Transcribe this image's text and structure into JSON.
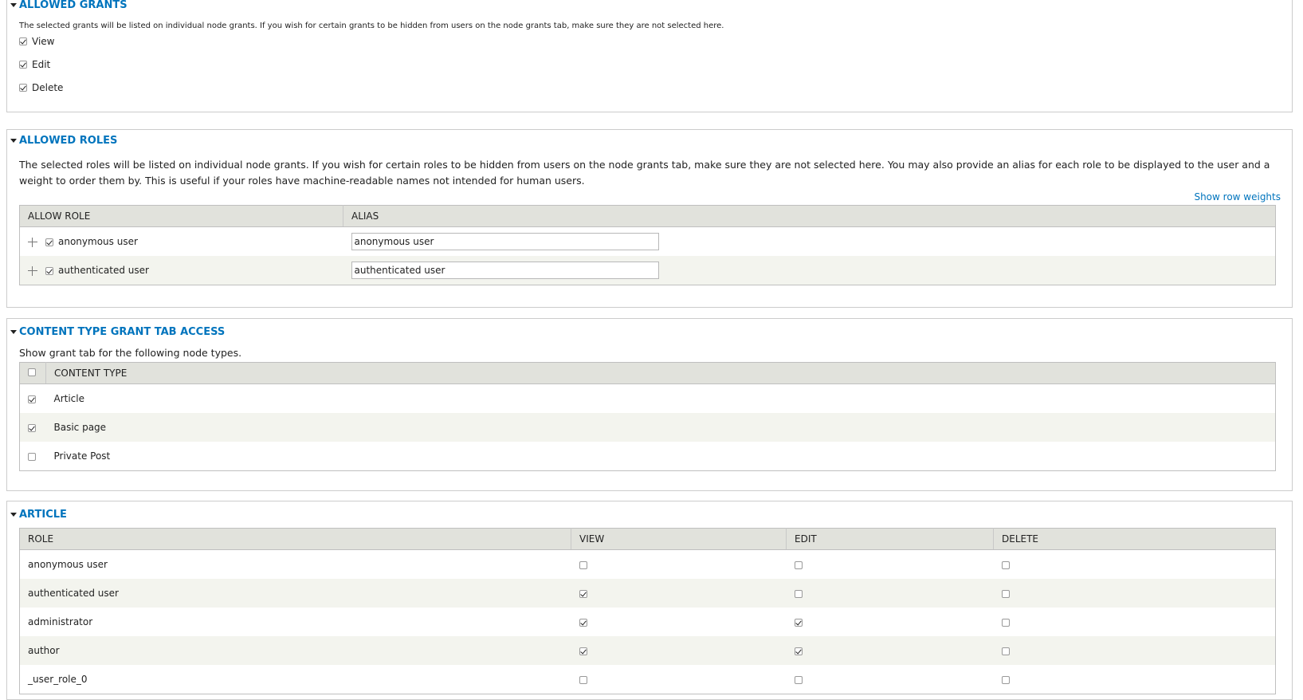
{
  "grants": {
    "title": "ALLOWED GRANTS",
    "description": "The selected grants will be listed on individual node grants. If you wish for certain grants to be hidden from users on the node grants tab, make sure they are not selected here.",
    "items": [
      {
        "label": "View",
        "checked": true
      },
      {
        "label": "Edit",
        "checked": true
      },
      {
        "label": "Delete",
        "checked": true
      }
    ]
  },
  "roles": {
    "title": "ALLOWED ROLES",
    "description": "The selected roles will be listed on individual node grants. If you wish for certain roles to be hidden from users on the node grants tab, make sure they are not selected here. You may also provide an alias for each role to be displayed to the user and a weight to order them by. This is useful if your roles have machine-readable names not intended for human users.",
    "show_weights": "Show row weights",
    "headers": [
      "ALLOW ROLE",
      "ALIAS"
    ],
    "rows": [
      {
        "label": "anonymous user",
        "checked": true,
        "alias": "anonymous user"
      },
      {
        "label": "authenticated user",
        "checked": true,
        "alias": "authenticated user"
      }
    ]
  },
  "content_types": {
    "title": "CONTENT TYPE GRANT TAB ACCESS",
    "description": "Show grant tab for the following node types.",
    "header": "CONTENT TYPE",
    "rows": [
      {
        "label": "Article",
        "checked": true
      },
      {
        "label": "Basic page",
        "checked": true
      },
      {
        "label": "Private Post",
        "checked": false
      }
    ]
  },
  "article": {
    "title": "ARTICLE",
    "headers": [
      "ROLE",
      "VIEW",
      "EDIT",
      "DELETE"
    ],
    "rows": [
      {
        "role": "anonymous user",
        "view": false,
        "edit": false,
        "delete": false
      },
      {
        "role": "authenticated user",
        "view": true,
        "edit": false,
        "delete": false
      },
      {
        "role": "administrator",
        "view": true,
        "edit": true,
        "delete": false
      },
      {
        "role": "author",
        "view": true,
        "edit": true,
        "delete": false
      },
      {
        "role": "_user_role_0",
        "view": false,
        "edit": false,
        "delete": false
      }
    ]
  }
}
